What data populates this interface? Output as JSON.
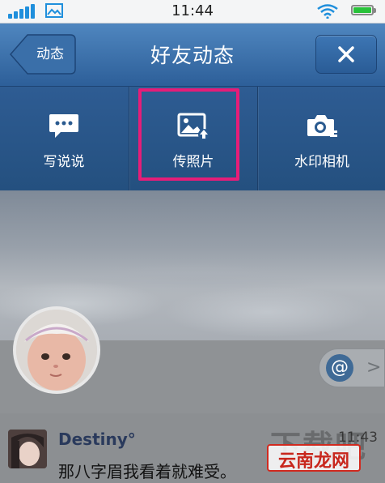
{
  "status_bar": {
    "time": "11:44",
    "icons": [
      "signal-icon",
      "image-icon",
      "wifi-icon",
      "battery-icon"
    ]
  },
  "nav": {
    "back_label": "动态",
    "title": "好友动态",
    "close_icon": "close-icon"
  },
  "actions": [
    {
      "label": "写说说",
      "icon": "chat-bubble-icon"
    },
    {
      "label": "传照片",
      "icon": "photo-upload-icon"
    },
    {
      "label": "水印相机",
      "icon": "camera-icon"
    }
  ],
  "profile": {
    "mention_icon": "at-icon",
    "mention_symbol": "@",
    "chevron": ">"
  },
  "feed": {
    "author": "Destiny°",
    "time": "11:43",
    "text": "那八字眉我看着就难受。"
  },
  "watermark": {
    "text": "云南龙网",
    "faded_text": "下载吧"
  },
  "colors": {
    "nav_blue": "#3a6ea8",
    "highlight": "#e61d78",
    "signal": "#1f8fdc",
    "battery": "#29c23a"
  }
}
